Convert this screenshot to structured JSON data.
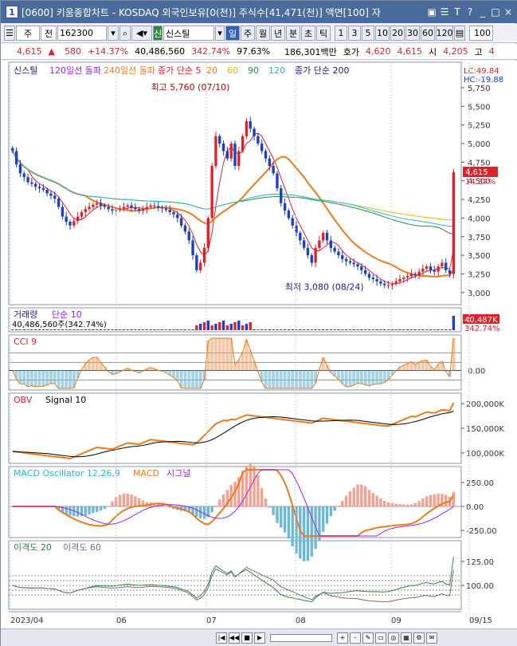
{
  "window": {
    "title": "[0600] 키움종합차트 - KOSDAQ 외국인보유[0(천)] 주식수[41,471(천)] 액면[100] 자",
    "app_number": "1",
    "buttons": [
      "▣",
      "☰",
      "T",
      "?",
      "_",
      "□",
      "×"
    ]
  },
  "toolbar": {
    "period": "주",
    "type": "전",
    "code": "162300",
    "name": "신스틸",
    "tabs": [
      "일",
      "주",
      "월",
      "년",
      "분",
      "초",
      "틱"
    ],
    "active_tab": "일",
    "numbers": [
      "1",
      "3",
      "5",
      "10",
      "20",
      "30",
      "60",
      "120"
    ],
    "count": "100"
  },
  "quote": {
    "price": "4,615",
    "arrow": "▲",
    "change": "580",
    "pct": "+14.37%",
    "volume": "40,486,560",
    "vol_ratio": "342.74%",
    "strength": "97.63%",
    "amount": "186,301백만",
    "hoga_label": "호가",
    "hoga": "4,620",
    "cur": "4,615",
    "open_label": "시",
    "open": "4,205",
    "high_label": "고",
    "high": "4"
  },
  "colors": {
    "up": "#e0202a",
    "down": "#1a3fc8",
    "orange": "#f07a1a",
    "purple": "#a020f0",
    "gold": "#e8b800",
    "green": "#2b8a3e",
    "cyan": "#20b8e0",
    "navy": "#1a1a8a",
    "gray": "#707070"
  },
  "chart_data": [
    {
      "type": "candlestick",
      "legend": [
        "신스틸",
        "120일선 돌파",
        "240일선 돌파",
        "종가 단순 5",
        "20",
        "60",
        "90",
        "120",
        "종가 단순 200"
      ],
      "y_ticks": [
        "5,750",
        "5,500",
        "5,250",
        "5,000",
        "4,750",
        "4,500",
        "4,250",
        "4,000",
        "3,750",
        "3,500",
        "3,250",
        "3,000"
      ],
      "y_values": [
        5750,
        5500,
        5250,
        5000,
        4750,
        4500,
        4250,
        4000,
        3750,
        3500,
        3250,
        3000
      ],
      "ylim": [
        2880,
        5900
      ],
      "lc": "LC:49.84",
      "hc": "HC:-19.88",
      "current_price": "4,615",
      "current_pct": "14.37%",
      "max_label": "최고 5,760 (07/10)",
      "min_label": "최저 3,080 (08/24)",
      "x_ticks": [
        "2023/04",
        "06",
        "07",
        "08",
        "09",
        "09/15"
      ],
      "closes": [
        4900,
        4720,
        4600,
        4550,
        4480,
        4460,
        4420,
        4400,
        4380,
        4330,
        4300,
        4260,
        4150,
        4020,
        3950,
        3900,
        3960,
        4020,
        4080,
        4120,
        4150,
        4180,
        4200,
        4170,
        4150,
        4120,
        4100,
        4110,
        4130,
        4150,
        4170,
        4140,
        4120,
        4100,
        4120,
        4150,
        4170,
        4160,
        4140,
        4130,
        4110,
        4080,
        4050,
        4000,
        3900,
        3820,
        3700,
        3500,
        3300,
        3400,
        3600,
        4000,
        4700,
        5100,
        5000,
        4900,
        4800,
        5000,
        4700,
        4900,
        5100,
        5300,
        5200,
        5100,
        5000,
        4900,
        4800,
        4700,
        4600,
        4400,
        4200,
        4100,
        4000,
        3900,
        3800,
        3700,
        3600,
        3500,
        3400,
        3600,
        3700,
        3800,
        3700,
        3600,
        3550,
        3500,
        3450,
        3420,
        3400,
        3380,
        3350,
        3300,
        3250,
        3200,
        3180,
        3150,
        3120,
        3100,
        3100,
        3120,
        3150,
        3180,
        3200,
        3220,
        3250,
        3230,
        3280,
        3320,
        3350,
        3300,
        3280,
        3350,
        3400,
        3300,
        3250,
        4615
      ],
      "volume_label": "거래량",
      "volume_ma_label": "단순 10",
      "volume_text": "40,486,560주(342.74%)",
      "volume_badge": "40,487K",
      "volume_badge_pct": "342.74%",
      "cci_label": "CCI 9",
      "cci_tick": "0.00",
      "obv_label": "OBV",
      "obv_signal_label": "Signal 10",
      "obv_ticks": [
        "200,000K",
        "150,000K",
        "100,000K"
      ],
      "macd_label": "MACD Oscillator 12,26,9",
      "macd_line_label": "MACD",
      "macd_signal_label": "시그널",
      "macd_ticks": [
        "250.00",
        "0.00",
        "-250.00"
      ],
      "disp_label1": "이격도 20",
      "disp_label2": "이격도 60",
      "disp_ticks": [
        "125.00",
        "100.00"
      ]
    }
  ]
}
